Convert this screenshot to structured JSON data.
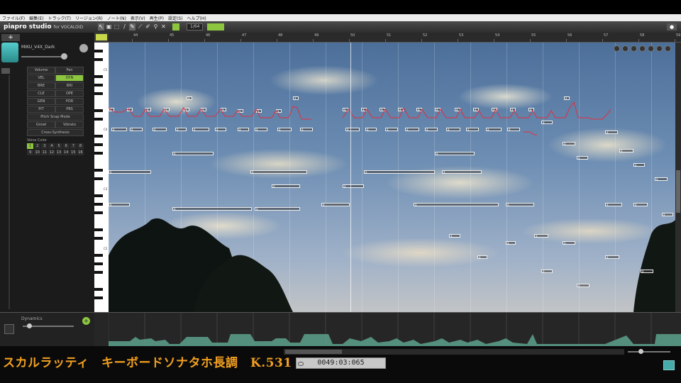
{
  "menu": [
    "ファイル(F)",
    "編集(E)",
    "トラック(T)",
    "リージョン(R)",
    "ノート(N)",
    "表示(V)",
    "再生(P)",
    "設定(S)",
    "ヘルプ(H)"
  ],
  "app": {
    "logo": "piapro studio",
    "logo_sub": "for VOCALOID",
    "quantize": "1/64",
    "snap_label": ""
  },
  "track": {
    "name": "MIKU_V4X_Dark",
    "add_label": "+"
  },
  "params": [
    [
      "Volume",
      "Pan"
    ],
    [
      "VEL",
      "DYN"
    ],
    [
      "BRE",
      "BRI"
    ],
    [
      "CLE",
      "OPE"
    ],
    [
      "GEN",
      "POR"
    ],
    [
      "PIT",
      "PBS"
    ],
    [
      "Pitch Snap Mode"
    ],
    [
      "Growl",
      "Vibrato"
    ],
    [
      "Cross-Synthesis"
    ]
  ],
  "voice_title": "Voice Color",
  "voices": [
    "1",
    "2",
    "3",
    "4",
    "5",
    "6",
    "7",
    "8",
    "9",
    "10",
    "11",
    "12",
    "13",
    "14",
    "15",
    "16"
  ],
  "ruler_bars": [
    "44",
    "45",
    "46",
    "47",
    "48",
    "49",
    "50",
    "51",
    "52",
    "53",
    "54",
    "55",
    "56",
    "57",
    "58",
    "59"
  ],
  "key_labels": [
    "C5",
    "C4",
    "C3",
    "C2"
  ],
  "dynamics_label": "Dynamics",
  "dynamics_add": "+",
  "song_title": "スカルラッティ　キーボードソナタホ長調　K.531",
  "time": "0049:03:065",
  "note_lyric": "a"
}
